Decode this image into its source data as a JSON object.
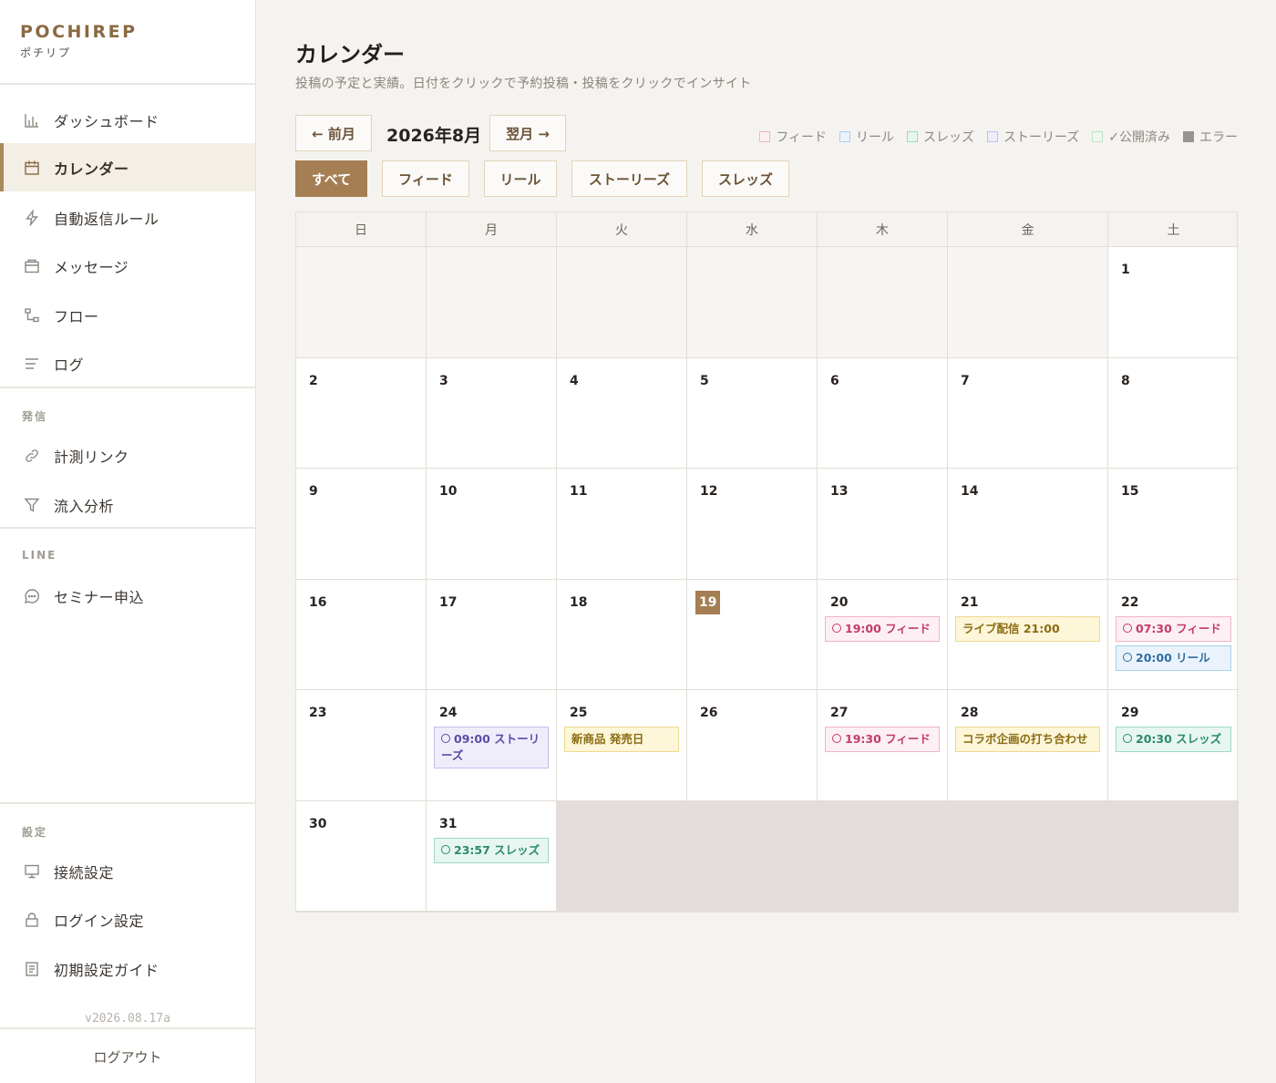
{
  "sidebar": {
    "brand": "POCHIREP",
    "brand_sub": "ポチリプ",
    "items": [
      {
        "label": "ダッシュボード"
      },
      {
        "label": "カレンダー"
      },
      {
        "label": "自動返信ルール"
      },
      {
        "label": "メッセージ"
      },
      {
        "label": "フロー"
      },
      {
        "label": "ログ"
      }
    ],
    "section_send": "発信",
    "send_items": [
      {
        "label": "計測リンク"
      },
      {
        "label": "流入分析"
      }
    ],
    "section_line": "LINE",
    "line_items": [
      {
        "label": "セミナー申込"
      }
    ],
    "section_settings": "設定",
    "settings_items": [
      {
        "label": "接続設定"
      },
      {
        "label": "ログイン設定"
      },
      {
        "label": "初期設定ガイド"
      }
    ],
    "version": "v2026.08.17a",
    "logout": "ログアウト"
  },
  "header": {
    "title": "カレンダー",
    "subtitle": "投稿の予定と実績。日付をクリックで予約投稿・投稿をクリックでインサイト"
  },
  "nav": {
    "prev": "← 前月",
    "month": "2026年8月",
    "next": "翌月 →"
  },
  "filters": [
    "すべて",
    "フィード",
    "リール",
    "ストーリーズ",
    "スレッズ"
  ],
  "legend": [
    {
      "label": "フィード",
      "color": "#f1b4c6"
    },
    {
      "label": "リール",
      "color": "#a9cfec"
    },
    {
      "label": "スレッズ",
      "color": "#9fd8c3"
    },
    {
      "label": "ストーリーズ",
      "color": "#c5bdee"
    },
    {
      "label": "✓公開済み",
      "color": "#bfe3c9"
    },
    {
      "label": "エラー",
      "color": "#9a9393"
    }
  ],
  "weekdays": [
    "日",
    "月",
    "火",
    "水",
    "木",
    "金",
    "土"
  ],
  "days": {
    "d1": "1",
    "d2": "2",
    "d3": "3",
    "d4": "4",
    "d5": "5",
    "d6": "6",
    "d7": "7",
    "d8": "8",
    "d9": "9",
    "d10": "10",
    "d11": "11",
    "d12": "12",
    "d13": "13",
    "d14": "14",
    "d15": "15",
    "d16": "16",
    "d17": "17",
    "d18": "18",
    "d19": "19",
    "d20": "20",
    "d21": "21",
    "d22": "22",
    "d23": "23",
    "d24": "24",
    "d25": "25",
    "d26": "26",
    "d27": "27",
    "d28": "28",
    "d29": "29",
    "d30": "30",
    "d31": "31"
  },
  "events": {
    "e20": "19:00 フィード",
    "e21": "ライブ配信 21:00",
    "e22a": "07:30 フィード",
    "e22b": "20:00 リール",
    "e24": "09:00 ストーリーズ",
    "e25": "新商品 発売日",
    "e27": "19:30 フィード",
    "e28": "コラボ企画の打ち合わせ",
    "e29": "20:30 スレッズ",
    "e31": "23:57 スレッズ"
  },
  "colors": {
    "accent": "#a57e53",
    "brand": "#8a6a43"
  }
}
